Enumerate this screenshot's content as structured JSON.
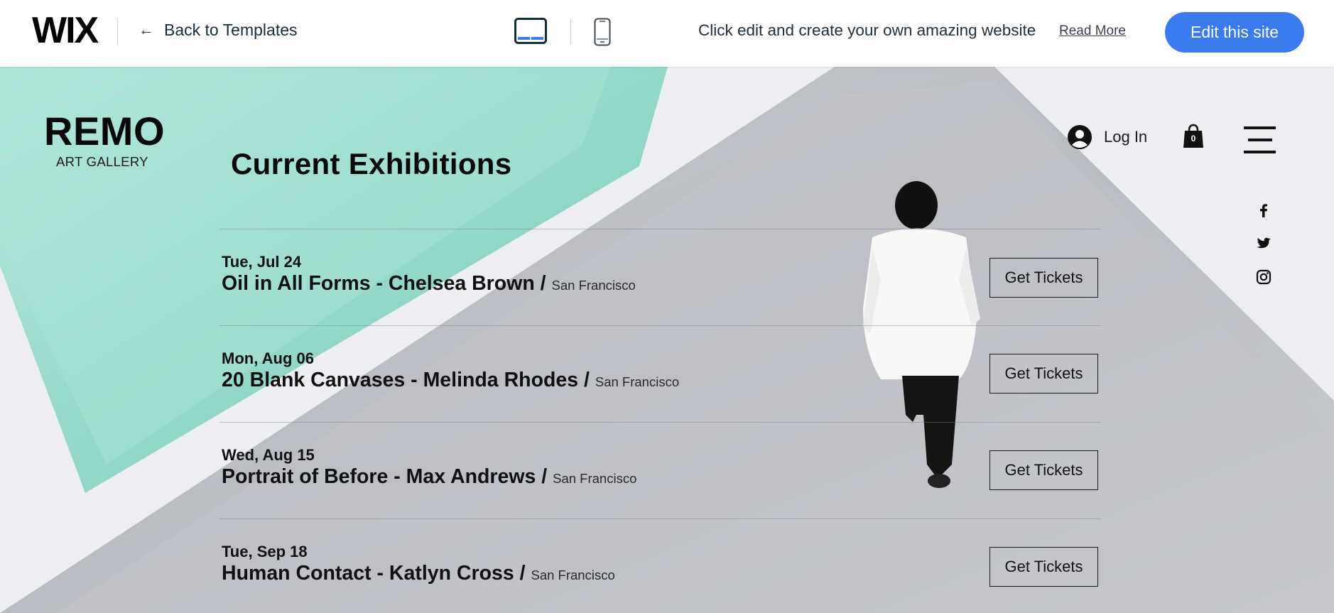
{
  "topbar": {
    "logo": "WIX",
    "back_label": "Back to Templates",
    "back_icon": "arrow-left-icon",
    "promo": "Click edit and create your own amazing website",
    "read_more": "Read More",
    "edit_button": "Edit this site",
    "accent": "#3b7bf0"
  },
  "site": {
    "brand": {
      "name": "REMO",
      "subtitle": "ART GALLERY"
    },
    "login_label": "Log In",
    "cart_count": "0",
    "section_title": "Current Exhibitions",
    "exhibitions": [
      {
        "date": "Tue, Jul 24",
        "title": "Oil in All Forms - Chelsea Brown /",
        "location": "San Francisco",
        "button": "Get Tickets"
      },
      {
        "date": "Mon, Aug 06",
        "title": "20 Blank Canvases - Melinda Rhodes /",
        "location": "San Francisco",
        "button": "Get Tickets"
      },
      {
        "date": "Wed, Aug 15",
        "title": "Portrait of Before - Max Andrews /",
        "location": "San Francisco",
        "button": "Get Tickets"
      },
      {
        "date": "Tue, Sep 18",
        "title": "Human Contact - Katlyn Cross /",
        "location": "San Francisco",
        "button": "Get Tickets"
      }
    ],
    "social": [
      "facebook-icon",
      "twitter-icon",
      "instagram-icon"
    ]
  }
}
